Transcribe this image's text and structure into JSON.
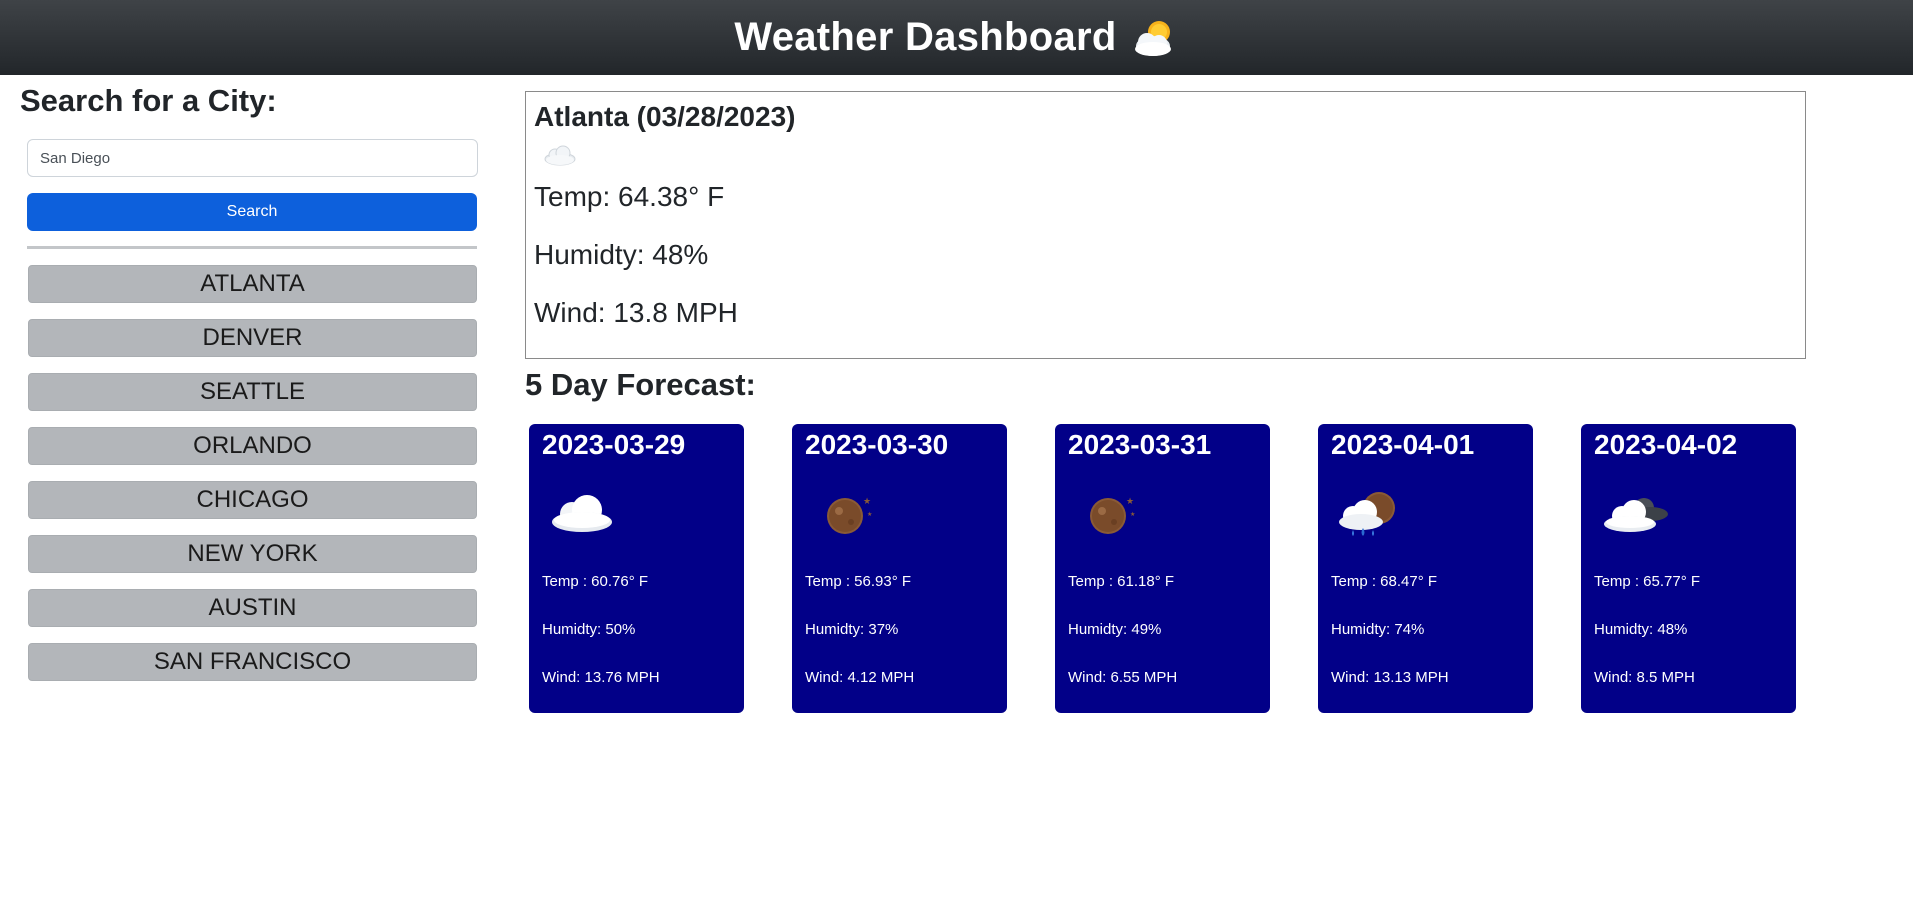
{
  "header": {
    "title": "Weather Dashboard",
    "icon": "sun-behind-cloud-icon"
  },
  "search": {
    "heading": "Search for a City:",
    "input_value": "San Diego",
    "button_label": "Search"
  },
  "history": [
    "ATLANTA",
    "DENVER",
    "SEATTLE",
    "ORLANDO",
    "CHICAGO",
    "NEW YORK",
    "AUSTIN",
    "SAN FRANCISCO"
  ],
  "current": {
    "title": "Atlanta (03/28/2023)",
    "icon": "cloud-icon",
    "temp": "Temp: 64.38° F",
    "humidity": "Humidty: 48%",
    "wind": "Wind: 13.8 MPH"
  },
  "forecast": {
    "heading": "5 Day Forecast:",
    "days": [
      {
        "date": "2023-03-29",
        "icon": "cloud-icon",
        "temp": "Temp : 60.76° F",
        "humidity": "Humidty: 50%",
        "wind": "Wind: 13.76 MPH"
      },
      {
        "date": "2023-03-30",
        "icon": "moon-icon",
        "temp": "Temp : 56.93° F",
        "humidity": "Humidty: 37%",
        "wind": "Wind: 4.12 MPH"
      },
      {
        "date": "2023-03-31",
        "icon": "moon-icon",
        "temp": "Temp : 61.18° F",
        "humidity": "Humidty: 49%",
        "wind": "Wind: 6.55 MPH"
      },
      {
        "date": "2023-04-01",
        "icon": "rain-cloud-moon-icon",
        "temp": "Temp : 68.47° F",
        "humidity": "Humidty: 74%",
        "wind": "Wind: 13.13 MPH"
      },
      {
        "date": "2023-04-02",
        "icon": "clouds-icon",
        "temp": "Temp : 65.77° F",
        "humidity": "Humidty: 48%",
        "wind": "Wind: 8.5 MPH"
      }
    ]
  },
  "colors": {
    "header_bg": "#2b2f33",
    "search_button": "#0d60dc",
    "history_button": "#b3b6ba",
    "forecast_card": "#020088"
  }
}
